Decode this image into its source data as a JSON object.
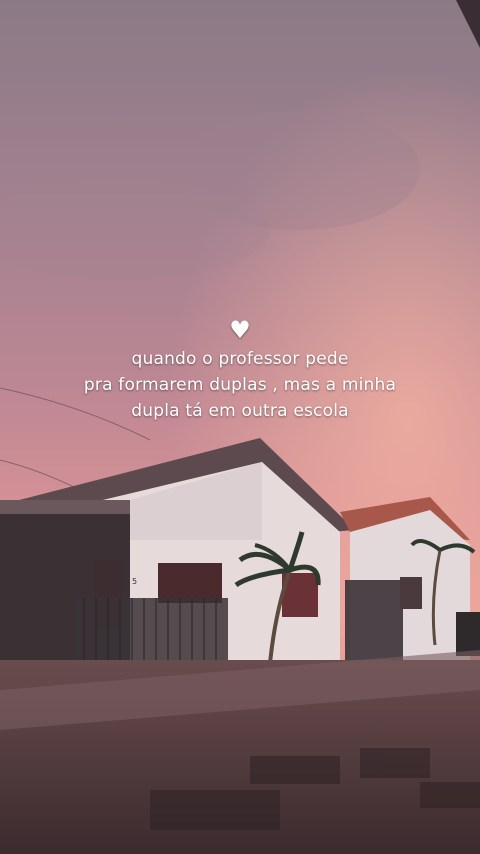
{
  "caption": {
    "icon": "white-heart-icon",
    "lines": [
      "quando o professor pede",
      "pra formarem duplas , mas a minha",
      "dupla tá em outra escola"
    ]
  },
  "photo": {
    "house_number": "5"
  },
  "colors": {
    "sky_top": "#8a7a86",
    "sky_mid": "#b98593",
    "sky_glow": "#e39a93",
    "wall": "#e8dfe0",
    "roof_tile": "#a8584b",
    "ground": "#4a3838"
  }
}
